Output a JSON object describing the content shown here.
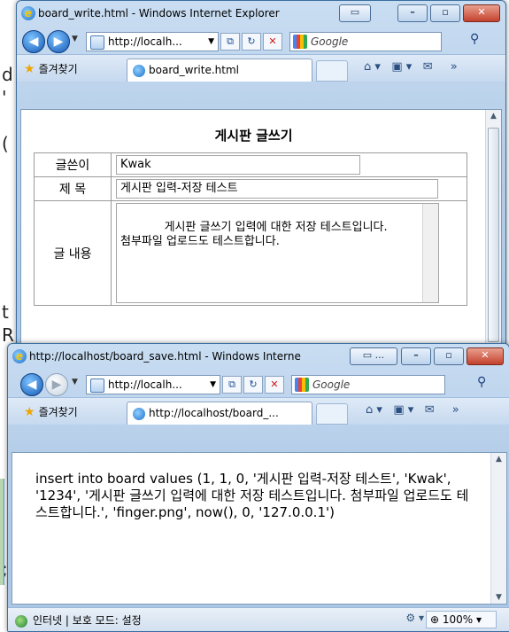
{
  "background_fragments": [
    "d",
    "'",
    "(",
    "t",
    "R",
    ";"
  ],
  "window1": {
    "title": "board_write.html - Windows Internet Explorer",
    "address": "http://localh...",
    "search_placeholder": "Google",
    "favorites_label": "즐겨찾기",
    "tab_label": "board_write.html",
    "form": {
      "heading": "게시판 글쓰기",
      "rows": [
        {
          "label": "글쓴이",
          "value": "Kwak"
        },
        {
          "label": "제 목",
          "value": "게시판 입력-저장 테스트"
        },
        {
          "label": "글 내용",
          "value": "게시판 글쓰기 입력에 대한 저장 테스트입니다.\n첨부파일 업로드도 테스트합니다."
        }
      ]
    }
  },
  "window2": {
    "title": "http://localhost/board_save.html - Windows Interne",
    "address": "http://localh...",
    "search_placeholder": "Google",
    "favorites_label": "즐겨찾기",
    "tab_label": "http://localhost/board_...",
    "body_text": "insert into board values (1, 1, 0, '게시판 입력-저장 테스트', 'Kwak', '1234', '게시판 글쓰기 입력에 대한 저장 테스트입니다. 첨부파일 업로드도 테스트합니다.', 'finger.png', now(), 0, '127.0.0.1')",
    "status": {
      "zone": "인터넷 | 보호 모드: 설정",
      "zoom": "100%"
    }
  }
}
